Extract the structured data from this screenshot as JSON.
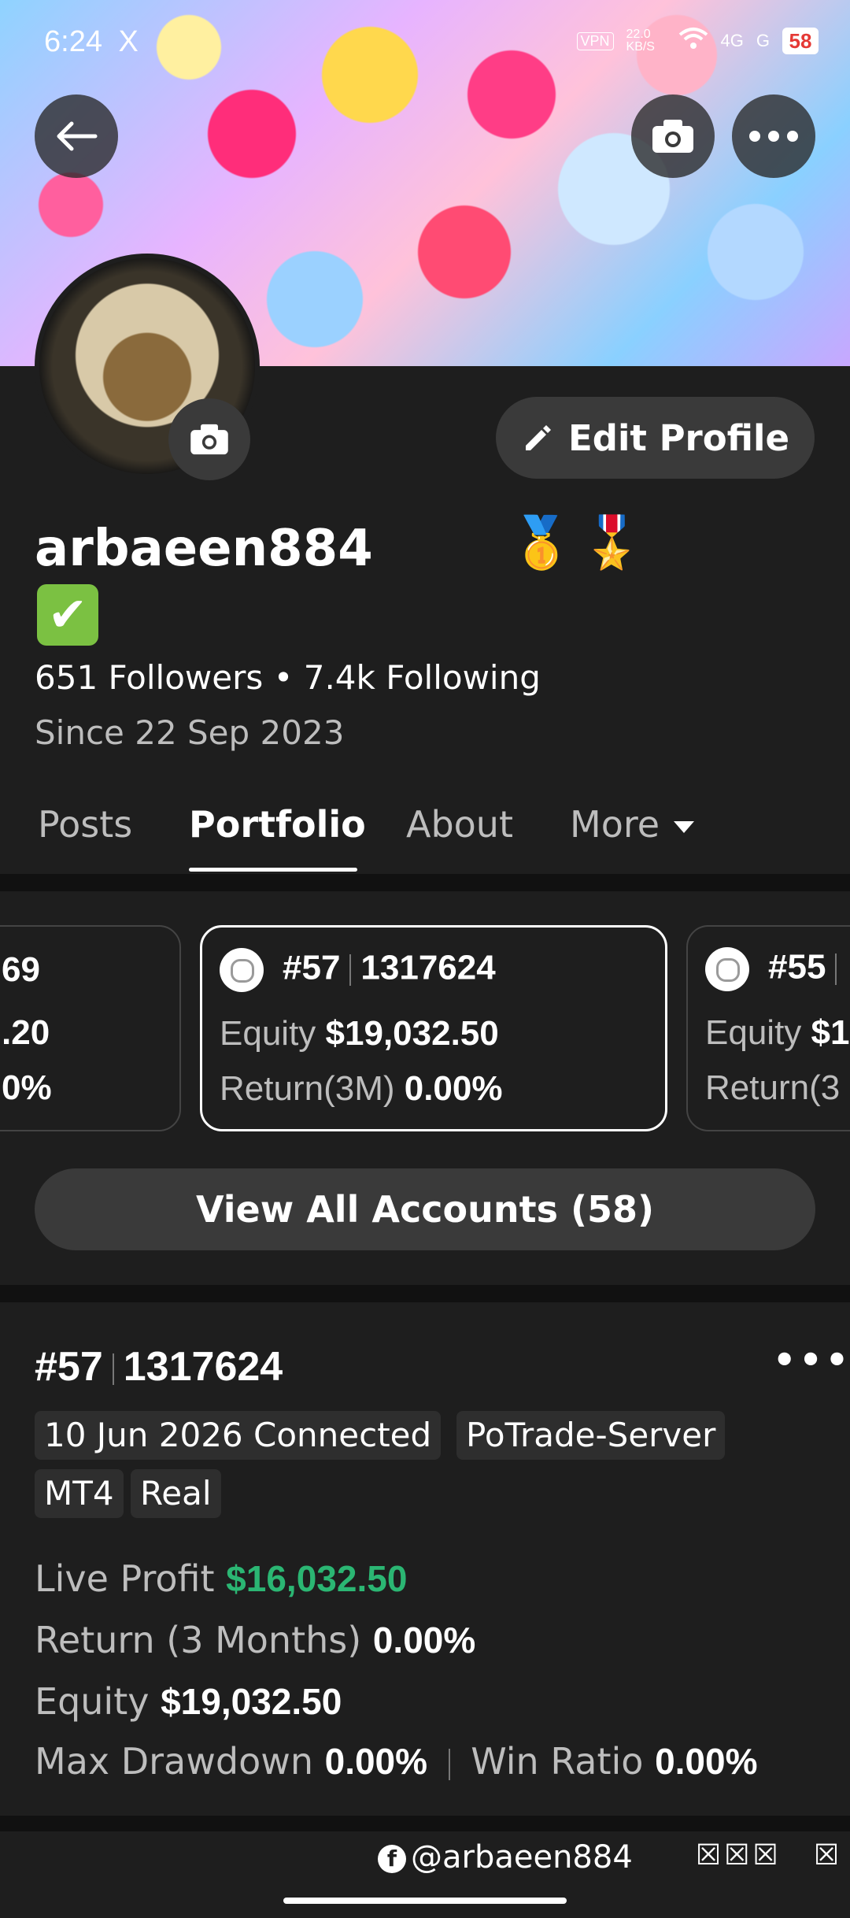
{
  "status_bar": {
    "time": "6:24",
    "x_icon": "X",
    "vpn": "VPN",
    "speed": "22.0 KB/S",
    "network1": "4G",
    "network2": "G",
    "battery": "58"
  },
  "header": {
    "back_icon": "back-arrow-icon",
    "camera_icon": "camera-icon",
    "more_icon": "more-icon"
  },
  "profile": {
    "edit_label": "Edit Profile",
    "username": "arbaeen884",
    "medals": "🥇🎖️",
    "verified": "✔",
    "followers": "651 Followers • 7.4k Following",
    "since": "Since 22 Sep 2023"
  },
  "tabs": {
    "posts": "Posts",
    "portfolio": "Portfolio",
    "about": "About",
    "more": "More"
  },
  "account_cards": {
    "left": {
      "number_partial": "69",
      "equity_partial": ".20",
      "return_partial": "0%"
    },
    "center": {
      "rank": "#57",
      "account": "1317624",
      "equity_label": "Equity",
      "equity_value": "$19,032.50",
      "return_label": "Return(3M)",
      "return_value": "0.00%"
    },
    "right": {
      "rank": "#55",
      "equity_label": "Equity",
      "equity_value_partial": "$1",
      "return_label_partial": "Return(3"
    }
  },
  "view_all": "View All Accounts (58)",
  "detail": {
    "rank": "#57",
    "account": "1317624",
    "more": "•••",
    "tags": [
      "10 Jun 2026 Connected",
      "PoTrade-Server",
      "MT4",
      "Real"
    ],
    "live_profit_label": "Live Profit",
    "live_profit_value": "$16,032.50",
    "return_label": "Return (3 Months)",
    "return_value": "0.00%",
    "equity_label": "Equity",
    "equity_value": "$19,032.50",
    "max_drawdown_label": "Max Drawdown",
    "max_drawdown_value": "0.00%",
    "win_ratio_label": "Win Ratio",
    "win_ratio_value": "0.00%"
  },
  "footer": {
    "fb_icon": "f",
    "handle": "@arbaeen884",
    "marks": "☒☒☒",
    "mark_single": "☒"
  },
  "colors": {
    "background": "#1e1e1e",
    "green": "#2bb673",
    "button": "#3a3a3a"
  }
}
